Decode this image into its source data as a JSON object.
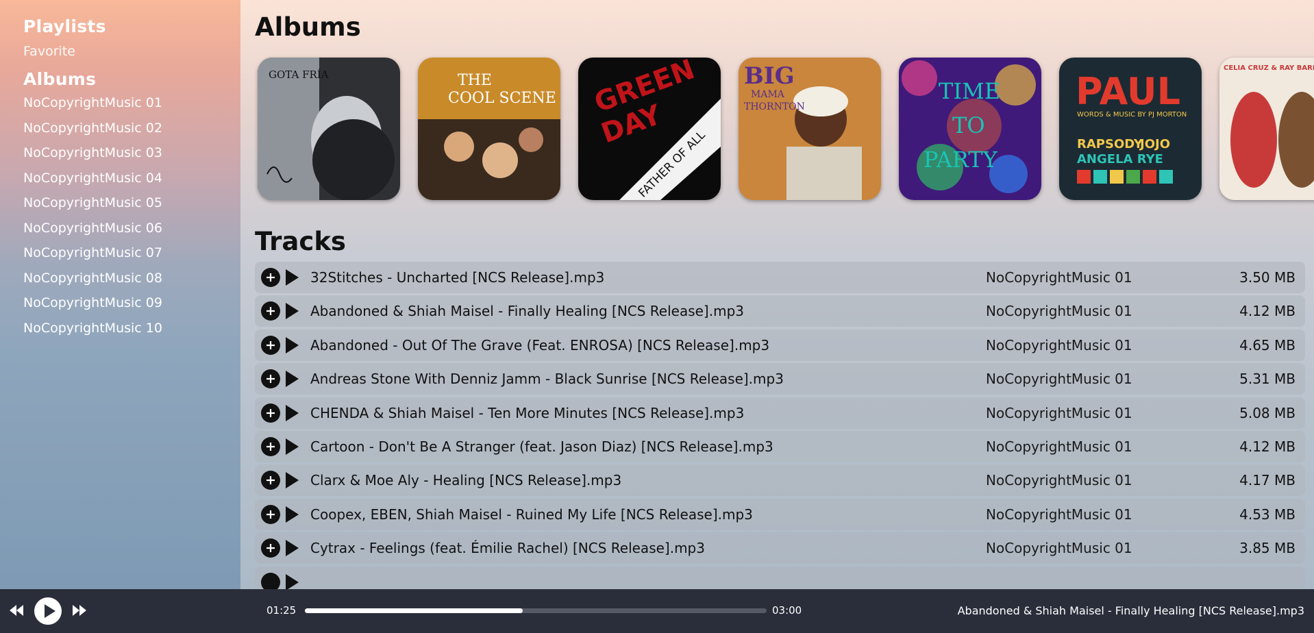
{
  "sidebar": {
    "playlists_heading": "Playlists",
    "playlists": [
      "Favorite"
    ],
    "albums_heading": "Albums",
    "albums": [
      "NoCopyrightMusic 01",
      "NoCopyrightMusic 02",
      "NoCopyrightMusic 03",
      "NoCopyrightMusic 04",
      "NoCopyrightMusic 05",
      "NoCopyrightMusic 06",
      "NoCopyrightMusic 07",
      "NoCopyrightMusic 08",
      "NoCopyrightMusic 09",
      "NoCopyrightMusic 10"
    ]
  },
  "main": {
    "albums_title": "Albums",
    "tracks_title": "Tracks",
    "album_covers": [
      {
        "cover_text": "GOTA FRÍA",
        "palette": [
          "#2e3034",
          "#9fa4ab"
        ]
      },
      {
        "cover_text": "THE COOL SCENE",
        "palette": [
          "#c98b2a",
          "#3a2a1e"
        ]
      },
      {
        "cover_text": "GREEN DAY · FATHER OF ALL MOTHERFUCKERS",
        "palette": [
          "#0b0b0b",
          "#c0141a"
        ]
      },
      {
        "cover_text": "BIG MAMA THORNTON",
        "palette": [
          "#c9863c",
          "#5b2e8a"
        ]
      },
      {
        "cover_text": "TIME TO PARTY",
        "palette": [
          "#3f1a7a",
          "#19c4b6"
        ]
      },
      {
        "cover_text": "PAUL · RAPSODY · JOJO · ANGELA RYE",
        "palette": [
          "#1c2a33",
          "#e23b2e"
        ]
      },
      {
        "cover_text": "CELIA CRUZ & RAY BARRETTO · RITMO EN EL CORAZÓN",
        "palette": [
          "#f1e9de",
          "#c83a3a"
        ]
      }
    ],
    "tracks": [
      {
        "title": "32Stitches - Uncharted [NCS Release].mp3",
        "album": "NoCopyrightMusic 01",
        "size": "3.50 MB"
      },
      {
        "title": "Abandoned & Shiah Maisel - Finally Healing [NCS Release].mp3",
        "album": "NoCopyrightMusic 01",
        "size": "4.12 MB"
      },
      {
        "title": "Abandoned - Out Of The Grave (Feat. ENROSA) [NCS Release].mp3",
        "album": "NoCopyrightMusic 01",
        "size": "4.65 MB"
      },
      {
        "title": "Andreas Stone With Denniz Jamm - Black Sunrise [NCS Release].mp3",
        "album": "NoCopyrightMusic 01",
        "size": "5.31 MB"
      },
      {
        "title": "CHENDA & Shiah Maisel - Ten More Minutes [NCS Release].mp3",
        "album": "NoCopyrightMusic 01",
        "size": "5.08 MB"
      },
      {
        "title": "Cartoon - Don't Be A Stranger (feat. Jason Diaz) [NCS Release].mp3",
        "album": "NoCopyrightMusic 01",
        "size": "4.12 MB"
      },
      {
        "title": "Clarx & Moe Aly - Healing [NCS Release].mp3",
        "album": "NoCopyrightMusic 01",
        "size": "4.17 MB"
      },
      {
        "title": "Coopex, EBEN, Shiah Maisel - Ruined My Life [NCS Release].mp3",
        "album": "NoCopyrightMusic 01",
        "size": "4.53 MB"
      },
      {
        "title": "Cytrax - Feelings (feat. Émilie Rachel) [NCS Release].mp3",
        "album": "NoCopyrightMusic 01",
        "size": "3.85 MB"
      }
    ]
  },
  "player": {
    "current_time": "01:25",
    "duration": "03:00",
    "progress_fraction": 0.472,
    "now_playing": "Abandoned & Shiah Maisel - Finally Healing [NCS Release].mp3",
    "icons": {
      "previous": "rewind-icon",
      "play": "play-icon",
      "next": "fast-forward-icon"
    }
  },
  "colors": {
    "player_bg": "#2a2e3a",
    "row_bg": "#b0b5bd",
    "text_dark": "#111111"
  }
}
